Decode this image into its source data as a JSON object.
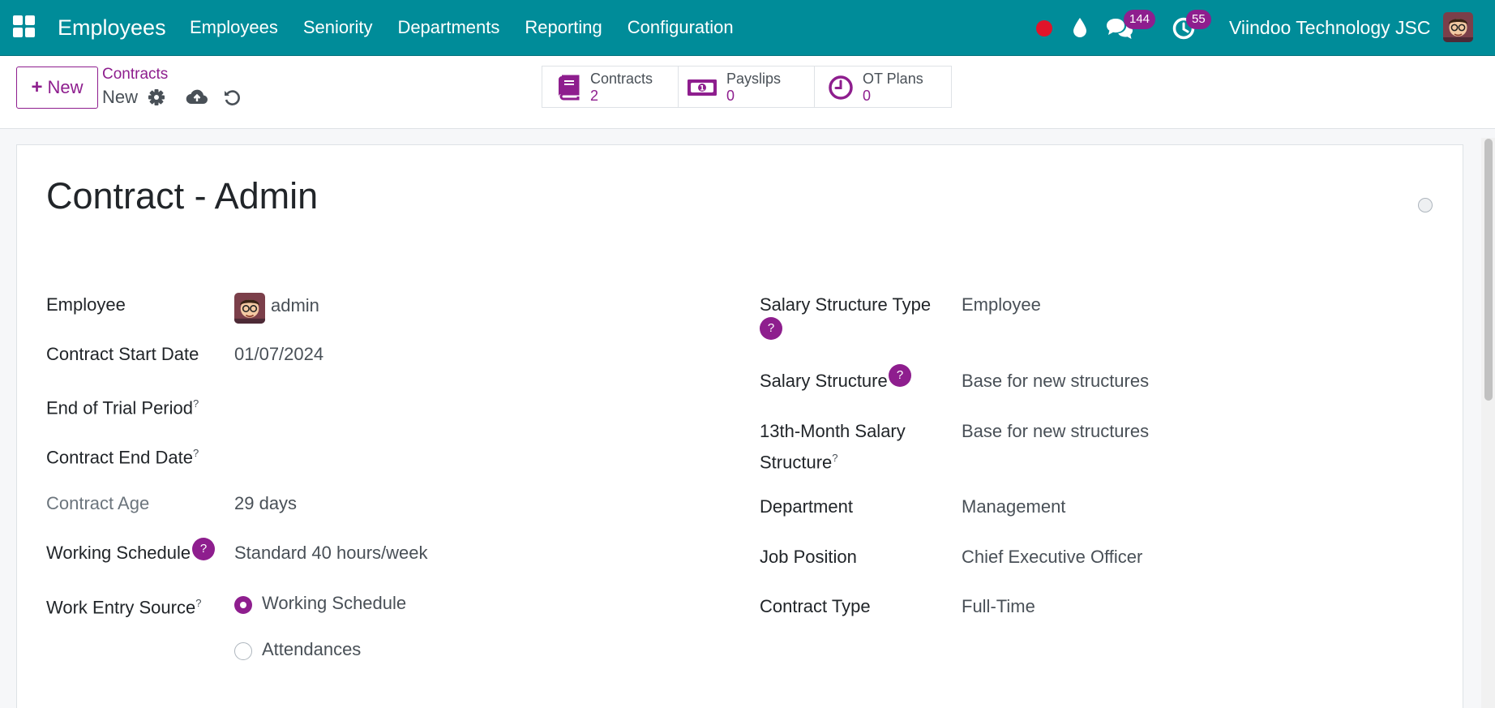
{
  "navbar": {
    "app_name": "Employees",
    "menu": [
      "Employees",
      "Seniority",
      "Departments",
      "Reporting",
      "Configuration"
    ],
    "icons": [
      "apps-grid-icon",
      "record-dot-icon",
      "water-drop-icon",
      "chat-bubbles-icon",
      "activity-clock-icon"
    ],
    "messages_count": "144",
    "activities_count": "55",
    "company": "Viindoo Technology JSC",
    "colors": {
      "bar": "#008c99",
      "badge": "#8e1e8e",
      "record": "#e0142a"
    }
  },
  "control": {
    "new_label": "New",
    "breadcrumb_parent": "Contracts",
    "breadcrumb_current": "New",
    "smart_buttons": [
      {
        "label": "Contracts",
        "value": "2",
        "icon": "book-icon"
      },
      {
        "label": "Payslips",
        "value": "0",
        "icon": "money-bill-icon"
      },
      {
        "label": "OT Plans",
        "value": "0",
        "icon": "clock-icon"
      }
    ]
  },
  "form": {
    "title": "Contract - Admin",
    "left": {
      "employee_label": "Employee",
      "employee_value": "admin",
      "start_label": "Contract Start Date",
      "start_value": "01/07/2024",
      "trial_label": "End of Trial Period",
      "end_label": "Contract End Date",
      "age_label": "Contract Age",
      "age_value": "29 days",
      "schedule_label": "Working Schedule",
      "schedule_value": "Standard 40 hours/week",
      "source_label": "Work Entry Source",
      "source_options": [
        "Working Schedule",
        "Attendances"
      ],
      "source_selected": "Working Schedule"
    },
    "right": {
      "sst_label": "Salary Structure Type",
      "sst_value": "Employee",
      "ss_label": "Salary Structure",
      "ss_value": "Base for new structures",
      "s13_label_line1": "13th-Month Salary",
      "s13_label_line2": "Structure",
      "s13_value": "Base for new structures",
      "dept_label": "Department",
      "dept_value": "Management",
      "job_label": "Job Position",
      "job_value": "Chief Executive Officer",
      "type_label": "Contract Type",
      "type_value": "Full-Time"
    },
    "help_mark": "?",
    "tooltip_mark": "?"
  }
}
